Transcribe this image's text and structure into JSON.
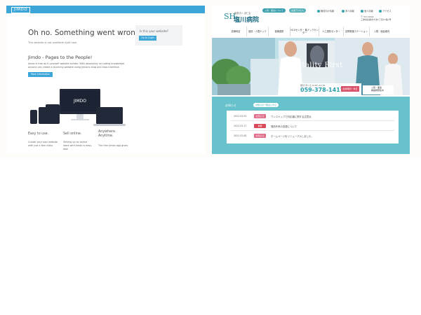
{
  "jimdo": {
    "logo": "JIMDO",
    "title": "Oh no. Something went wrong.",
    "subtitle": "This website is not available right now.",
    "owner_box": {
      "label": "Is this your website?",
      "button": "Go to Login"
    },
    "section_title": "Jimdo - Pages to the People!",
    "section_text": "Jimdo is free do it yourself website builder. With absolutely no coding knowledge, anyone can create a stunning website using Jimdo's drag and drop interface.",
    "more_button": "More information",
    "device_brand": "JIMDO",
    "features": [
      {
        "title": "Easy to use.",
        "text": "Create your own website with just a few clicks"
      },
      {
        "title": "Sell online.",
        "text": "Setting up an online store with Jimdo is easy. Add"
      },
      {
        "title": "Anywhere. Anytime.",
        "text": "The free Jimdo app gives"
      }
    ],
    "accent": "#3ca6d8"
  },
  "hospital": {
    "logo_mark": "SH",
    "logo_small": "医療法人 誠仁会",
    "logo_name": "塩川病院",
    "pills": [
      {
        "label": "入院・面会について",
        "color": "#3aa0ad"
      },
      {
        "label": "交通アクセス",
        "color": "#5ab0b8"
      }
    ],
    "top_links": [
      "職員向け情報",
      "求人情報",
      "個人情報",
      "アクセス"
    ],
    "address": [
      "〒 513-0004",
      "三重県鈴鹿市大池1丁目10番7号"
    ],
    "nav": [
      "診療科目",
      "健診・人間ドック",
      "医療連携",
      "HCUセンター 脳ドックセンター",
      "人工透析センター",
      "訪問看護ステーション",
      "入院・面会案内"
    ],
    "hero_text": "Hospitality First",
    "tel_label": "受付 月〜土 8:30〜11:30",
    "tel_number": "059-378-1417",
    "tel_button": "診療時間・休日",
    "hero_badge": [
      "入院・面会",
      "看護師募集中"
    ],
    "news_heading": "お知らせ",
    "news_all": "お知らせ一覧はこちら",
    "news": [
      {
        "date": "2022.03.03",
        "tag": "お知らせ",
        "tag_color": "#e06d8a",
        "title": "ワンストップで対応機に関する注意点"
      },
      {
        "date": "2022.03.17",
        "tag": "重要",
        "tag_color": "#d84a5a",
        "title": "発熱外来の変更について"
      },
      {
        "date": "2022.03.08",
        "tag": "お知らせ",
        "tag_color": "#e06d8a",
        "title": "ホームページをリニューアルしました。"
      }
    ],
    "accent": "#67c2cc"
  }
}
